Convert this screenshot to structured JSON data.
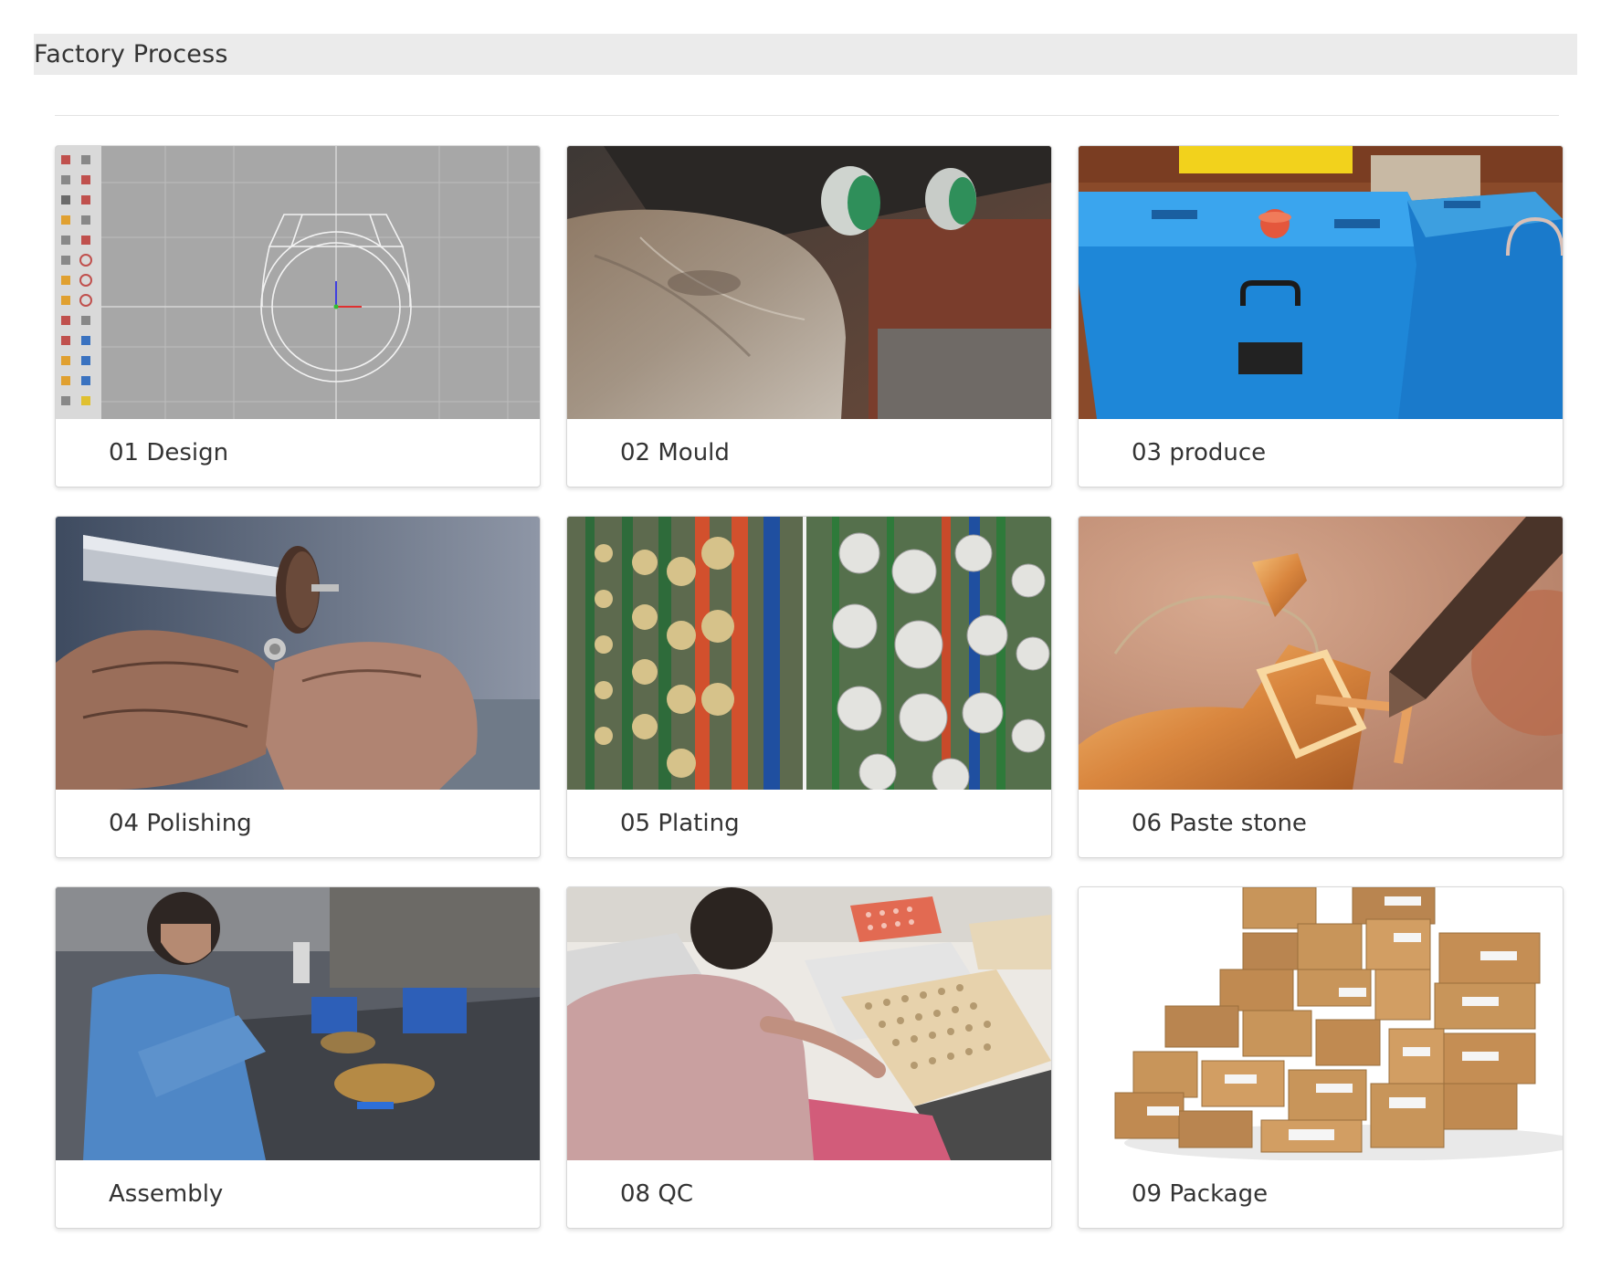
{
  "section": {
    "title": "Factory Process"
  },
  "cards": [
    {
      "label": "01 Design"
    },
    {
      "label": "02 Mould"
    },
    {
      "label": "03 produce"
    },
    {
      "label": "04 Polishing"
    },
    {
      "label": "05 Plating"
    },
    {
      "label": "06 Paste stone"
    },
    {
      "label": "Assembly"
    },
    {
      "label": "08 QC"
    },
    {
      "label": "09 Package"
    }
  ]
}
